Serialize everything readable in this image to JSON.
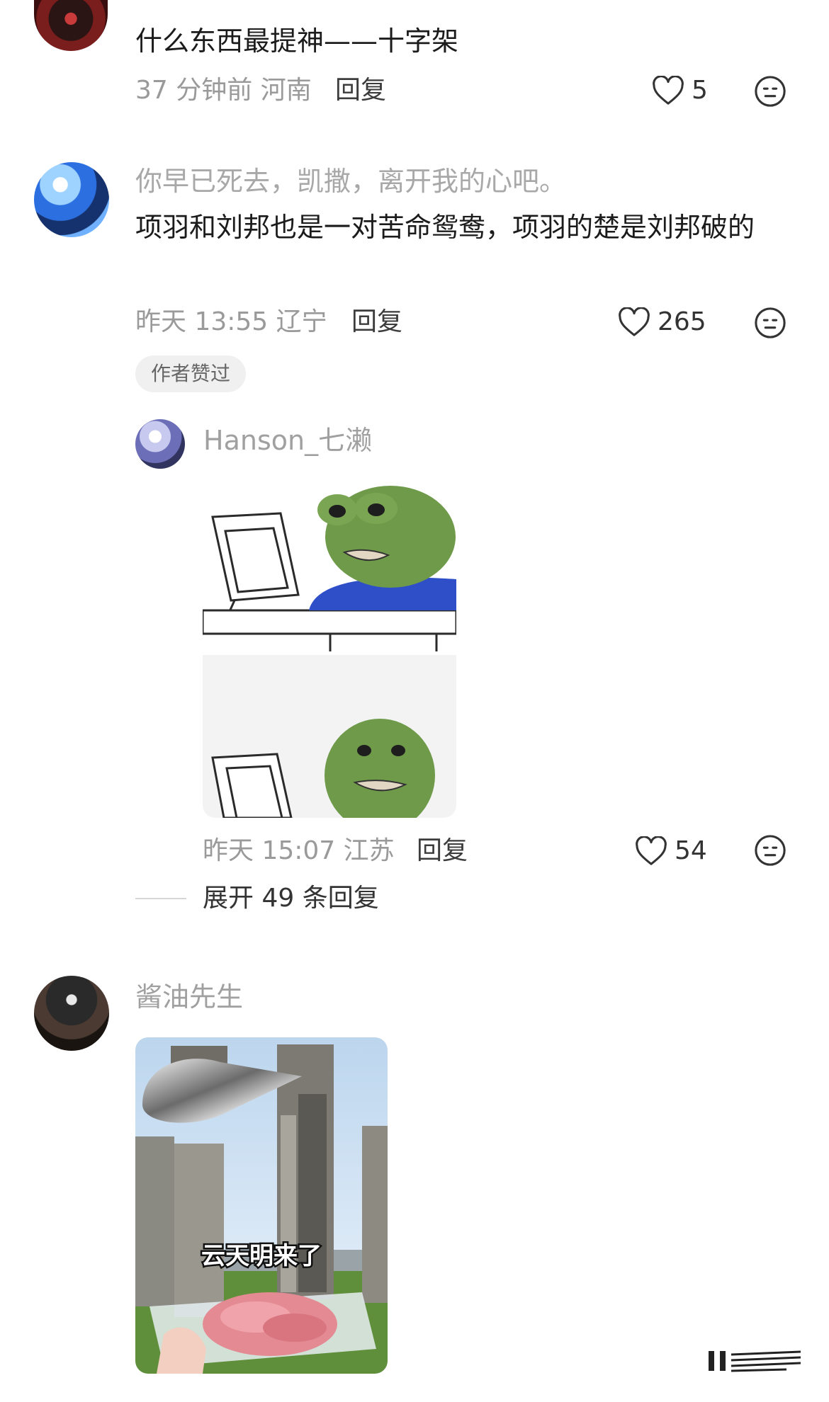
{
  "comments": [
    {
      "text": "什么东西最提神——十字架",
      "time": "37 分钟前",
      "location": "河南",
      "reply": "回复",
      "likes": "5"
    },
    {
      "quote": "你早已死去，凯撒，离开我的心吧。",
      "text": "项羽和刘邦也是一对苦命鸳鸯，项羽的楚是刘邦破的",
      "time": "昨天 13:55",
      "location": "辽宁",
      "reply": "回复",
      "likes": "265",
      "tag": "作者赞过",
      "sub_reply": {
        "username": "Hanson_七濑",
        "time": "昨天 15:07",
        "location": "江苏",
        "reply": "回复",
        "likes": "54"
      },
      "expand": "展开 49 条回复"
    },
    {
      "username": "酱油先生",
      "image_caption": "云天明来了"
    }
  ],
  "colors": {
    "text_main": "#1b1b1b",
    "text_muted": "#9a9a9a",
    "tag_bg": "#f0f0f0",
    "pepe_green": "#6e9a4a",
    "shirt_blue": "#2f4fc9"
  },
  "icons": [
    "heart-outline-icon",
    "emoji-reaction-icon",
    "menu-lines-icon"
  ]
}
